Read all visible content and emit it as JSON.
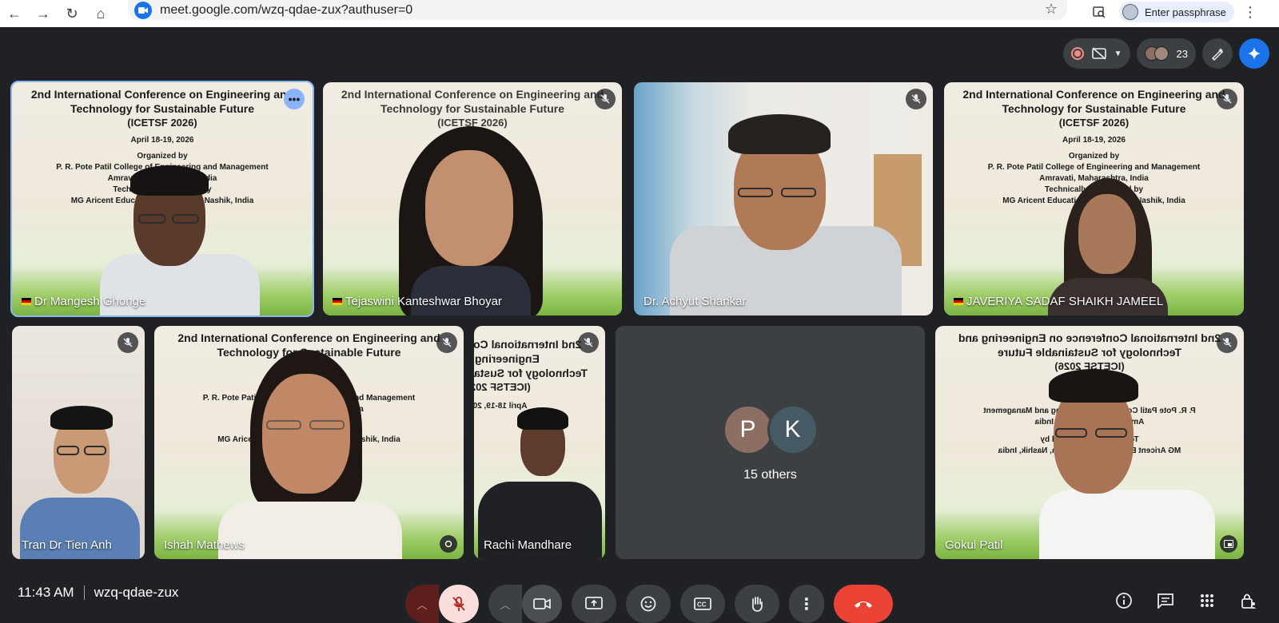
{
  "browser": {
    "url": "meet.google.com/wzq-qdae-zux?authuser=0",
    "profile_label": "Enter passphrase"
  },
  "topbar": {
    "participant_count": "23"
  },
  "banner": {
    "line1": "2nd International Conference on Engineering and",
    "line2": "Technology for Sustainable Future",
    "line3": "(ICETSF 2026)",
    "date": "April 18-19, 2026",
    "organized": "Organized by",
    "college": "P. R. Pote Patil College of Engineering and Management",
    "city": "Amravati, Maharashtra, India",
    "tech": "Technically Sponsored by",
    "sponsor": "MG Aricent Education Foundation, Nashik, India"
  },
  "tiles": [
    {
      "name": "Dr Mangesh Ghonge",
      "muted": false
    },
    {
      "name": "Tejaswini Kanteshwar Bhoyar",
      "muted": true
    },
    {
      "name": "Dr. Achyut Shankar",
      "muted": true
    },
    {
      "name": "JAVERIYA SADAF SHAIKH JAMEEL",
      "muted": true
    },
    {
      "name": "Tran Dr Tien Anh",
      "muted": true
    },
    {
      "name": "Ishah Mathews",
      "muted": true
    },
    {
      "name": "Rachi Mandhare",
      "muted": true
    },
    {
      "name": "Gokul Patil",
      "muted": true
    }
  ],
  "others": {
    "avatars": [
      "P",
      "K"
    ],
    "label": "15 others",
    "colors": [
      "#8d6e63",
      "#455a64"
    ]
  },
  "meeting": {
    "time": "11:43 AM",
    "code": "wzq-qdae-zux"
  }
}
